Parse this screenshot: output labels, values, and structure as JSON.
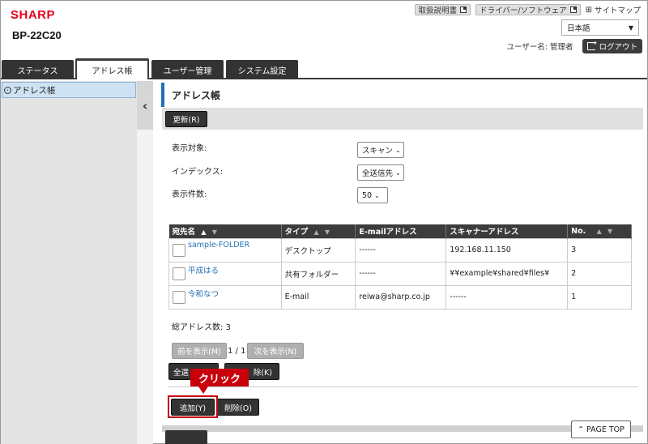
{
  "header": {
    "brand": "SHARP",
    "model": "BP-22C20",
    "links": {
      "manual": "取扱説明書",
      "driver": "ドライバー/ソフトウェア",
      "sitemap": "サイトマップ"
    },
    "language": "日本語",
    "user_label": "ユーザー名: 管理者",
    "logout": "ログアウト"
  },
  "tabs": [
    {
      "label": "ステータス",
      "active": false
    },
    {
      "label": "アドレス帳",
      "active": true
    },
    {
      "label": "ユーザー管理",
      "active": false
    },
    {
      "label": "システム設定",
      "active": false
    }
  ],
  "sidebar": {
    "items": [
      {
        "label": "アドレス帳",
        "selected": true
      }
    ]
  },
  "main": {
    "title": "アドレス帳",
    "refresh_button": "更新(R)",
    "filters": [
      {
        "label": "表示対象:",
        "value": "スキャン"
      },
      {
        "label": "インデックス:",
        "value": "全送信先"
      },
      {
        "label": "表示件数:",
        "value": "50"
      }
    ],
    "table": {
      "columns": [
        "宛先名",
        "タイプ",
        "E-mailアドレス",
        "スキャナーアドレス",
        "No."
      ],
      "rows": [
        {
          "name": "sample-FOLDER",
          "type": "デスクトップ",
          "email": "------",
          "scanner": "192.168.11.150",
          "no": "3"
        },
        {
          "name": "平成はる",
          "type": "共有フォルダー",
          "email": "------",
          "scanner": "¥¥example¥shared¥files¥",
          "no": "2"
        },
        {
          "name": "令和なつ",
          "type": "E-mail",
          "email": "reiwa@sharp.co.jp",
          "scanner": "------",
          "no": "1"
        }
      ]
    },
    "total": "総アドレス数: 3",
    "pager": {
      "prev": "前を表示(M)",
      "page": "1 / 1",
      "next": "次を表示(N)"
    },
    "select_all": "全選",
    "deselect_tail": "除(K)",
    "add_button": "追加(Y)",
    "delete_button": "削除(O)",
    "page_top": "PAGE TOP"
  },
  "annotation": {
    "callout": "クリック",
    "color": "#c7000b"
  }
}
